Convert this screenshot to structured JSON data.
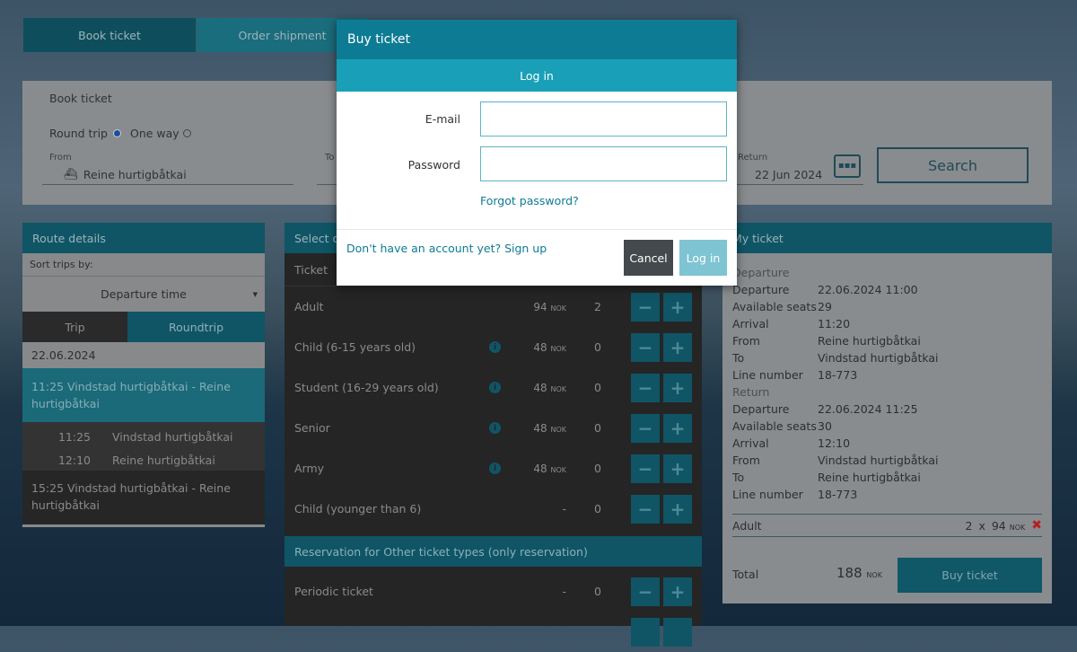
{
  "tabs": {
    "book": "Book ticket",
    "shipment": "Order shipment"
  },
  "booking": {
    "title": "Book ticket",
    "round_trip": "Round trip",
    "one_way": "One way",
    "from_label": "From",
    "from_value": "Reine hurtigbåtkai",
    "to_label": "To",
    "return_label": "Return",
    "return_value": "22 Jun 2024",
    "search": "Search"
  },
  "route": {
    "title": "Route details",
    "sort_label": "Sort trips by:",
    "sort_value": "Departure time",
    "tab_trip": "Trip",
    "tab_roundtrip": "Roundtrip",
    "date": "22.06.2024",
    "trips": [
      {
        "title": "11:25 Vindstad hurtigbåtkai - Reine hurtigbåtkai",
        "stops": [
          {
            "time": "11:25",
            "name": "Vindstad hurtigbåtkai"
          },
          {
            "time": "12:10",
            "name": "Reine hurtigbåtkai"
          }
        ]
      },
      {
        "title": "15:25 Vindstad hurtigbåtkai - Reine hurtigbåtkai"
      }
    ]
  },
  "tickets": {
    "title": "Select or",
    "header": "Ticket",
    "currency": "NOK",
    "rows": [
      {
        "name": "Adult",
        "price": "94",
        "qty": "2",
        "info": false
      },
      {
        "name": "Child (6-15 years old)",
        "price": "48",
        "qty": "0",
        "info": true
      },
      {
        "name": "Student (16-29 years old)",
        "price": "48",
        "qty": "0",
        "info": true
      },
      {
        "name": "Senior",
        "price": "48",
        "qty": "0",
        "info": true
      },
      {
        "name": "Army",
        "price": "48",
        "qty": "0",
        "info": true
      },
      {
        "name": "Child (younger than 6)",
        "price": "-",
        "qty": "0",
        "info": false
      }
    ],
    "reservation_header": "Reservation for Other ticket types (only reservation)",
    "periodic": {
      "name": "Periodic ticket",
      "price": "-",
      "qty": "0"
    }
  },
  "my_ticket": {
    "title": "My ticket",
    "departure_h": "Departure",
    "return_h": "Return",
    "departure": [
      [
        "Departure",
        "22.06.2024 11:00"
      ],
      [
        "Available seats",
        "29"
      ],
      [
        "Arrival",
        "11:20"
      ],
      [
        "From",
        "Reine hurtigbåtkai"
      ],
      [
        "To",
        "Vindstad hurtigbåtkai"
      ],
      [
        "Line number",
        "18-773"
      ]
    ],
    "return": [
      [
        "Departure",
        "22.06.2024 11:25"
      ],
      [
        "Available seats",
        "30"
      ],
      [
        "Arrival",
        "12:10"
      ],
      [
        "From",
        "Vindstad hurtigbåtkai"
      ],
      [
        "To",
        "Reine hurtigbåtkai"
      ],
      [
        "Line number",
        "18-773"
      ]
    ],
    "line_item": {
      "name": "Adult",
      "qty": "2",
      "x": "x",
      "price": "94",
      "currency": "NOK"
    },
    "total_label": "Total",
    "total": "188",
    "currency": "NOK",
    "buy": "Buy ticket"
  },
  "modal": {
    "title": "Buy ticket",
    "subtitle": "Log in",
    "email_label": "E-mail",
    "email_value": "",
    "password_label": "Password",
    "password_value": "",
    "forgot": "Forgot password?",
    "signup": "Don't have an account yet? Sign up",
    "cancel": "Cancel",
    "login": "Log in"
  },
  "colors": {
    "accent": "#0e7b94",
    "accent_light": "#19a0b8",
    "remove": "#c0201e"
  }
}
